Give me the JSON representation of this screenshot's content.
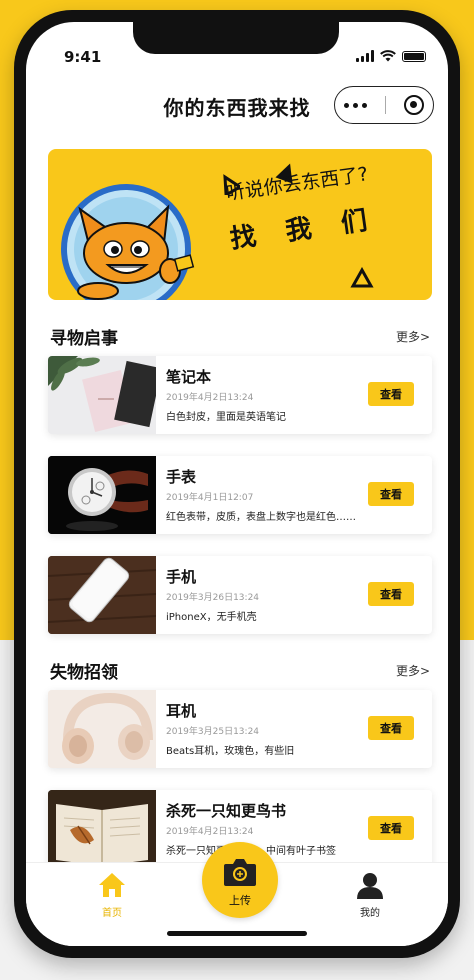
{
  "status_bar": {
    "time": "9:41"
  },
  "nav": {
    "title": "你的东西我来找"
  },
  "banner": {
    "line1": "听说你丢东西了?",
    "line2": "找我们"
  },
  "lost_section": {
    "title": "寻物启事",
    "more": "更多>"
  },
  "found_section": {
    "title": "失物招领",
    "more": "更多>"
  },
  "view_label": "查看",
  "lost_items": [
    {
      "title": "笔记本",
      "date": "2019年4月2日13:24",
      "desc": "白色封皮，里面是英语笔记"
    },
    {
      "title": "手表",
      "date": "2019年4月1日12:07",
      "desc": "红色表带，皮质，表盘上数字也是红色……"
    },
    {
      "title": "手机",
      "date": "2019年3月26日13:24",
      "desc": "iPhoneX，无手机壳"
    }
  ],
  "found_items": [
    {
      "title": "耳机",
      "date": "2019年3月25日13:24",
      "desc": "Beats耳机，玫瑰色，有些旧"
    },
    {
      "title": "杀死一只知更鸟书",
      "date": "2019年4月2日13:24",
      "desc": "杀死一只知更鸟的书，中间有叶子书签"
    }
  ],
  "tabbar": {
    "home": "首页",
    "upload": "上传",
    "mine": "我的"
  },
  "colors": {
    "accent": "#f9c71a",
    "text": "#111111"
  }
}
